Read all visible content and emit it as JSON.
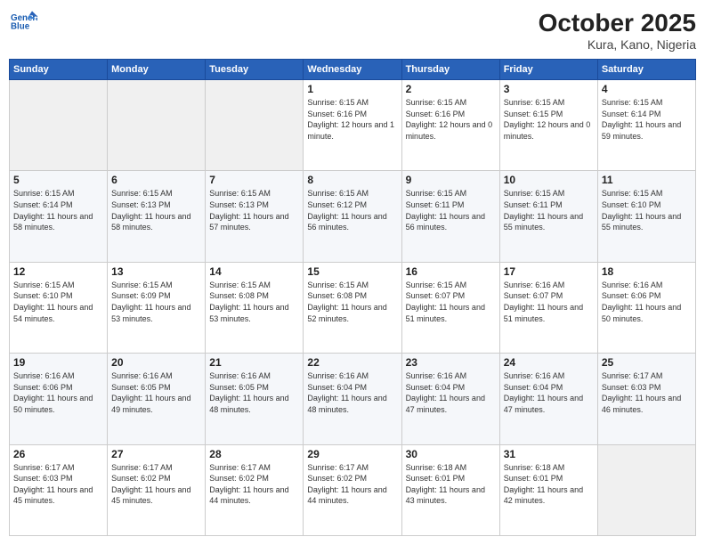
{
  "header": {
    "logo_line1": "General",
    "logo_line2": "Blue",
    "title": "October 2025",
    "subtitle": "Kura, Kano, Nigeria"
  },
  "weekdays": [
    "Sunday",
    "Monday",
    "Tuesday",
    "Wednesday",
    "Thursday",
    "Friday",
    "Saturday"
  ],
  "weeks": [
    [
      {
        "day": "",
        "sunrise": "",
        "sunset": "",
        "daylight": ""
      },
      {
        "day": "",
        "sunrise": "",
        "sunset": "",
        "daylight": ""
      },
      {
        "day": "",
        "sunrise": "",
        "sunset": "",
        "daylight": ""
      },
      {
        "day": "1",
        "sunrise": "Sunrise: 6:15 AM",
        "sunset": "Sunset: 6:16 PM",
        "daylight": "Daylight: 12 hours and 1 minute."
      },
      {
        "day": "2",
        "sunrise": "Sunrise: 6:15 AM",
        "sunset": "Sunset: 6:16 PM",
        "daylight": "Daylight: 12 hours and 0 minutes."
      },
      {
        "day": "3",
        "sunrise": "Sunrise: 6:15 AM",
        "sunset": "Sunset: 6:15 PM",
        "daylight": "Daylight: 12 hours and 0 minutes."
      },
      {
        "day": "4",
        "sunrise": "Sunrise: 6:15 AM",
        "sunset": "Sunset: 6:14 PM",
        "daylight": "Daylight: 11 hours and 59 minutes."
      }
    ],
    [
      {
        "day": "5",
        "sunrise": "Sunrise: 6:15 AM",
        "sunset": "Sunset: 6:14 PM",
        "daylight": "Daylight: 11 hours and 58 minutes."
      },
      {
        "day": "6",
        "sunrise": "Sunrise: 6:15 AM",
        "sunset": "Sunset: 6:13 PM",
        "daylight": "Daylight: 11 hours and 58 minutes."
      },
      {
        "day": "7",
        "sunrise": "Sunrise: 6:15 AM",
        "sunset": "Sunset: 6:13 PM",
        "daylight": "Daylight: 11 hours and 57 minutes."
      },
      {
        "day": "8",
        "sunrise": "Sunrise: 6:15 AM",
        "sunset": "Sunset: 6:12 PM",
        "daylight": "Daylight: 11 hours and 56 minutes."
      },
      {
        "day": "9",
        "sunrise": "Sunrise: 6:15 AM",
        "sunset": "Sunset: 6:11 PM",
        "daylight": "Daylight: 11 hours and 56 minutes."
      },
      {
        "day": "10",
        "sunrise": "Sunrise: 6:15 AM",
        "sunset": "Sunset: 6:11 PM",
        "daylight": "Daylight: 11 hours and 55 minutes."
      },
      {
        "day": "11",
        "sunrise": "Sunrise: 6:15 AM",
        "sunset": "Sunset: 6:10 PM",
        "daylight": "Daylight: 11 hours and 55 minutes."
      }
    ],
    [
      {
        "day": "12",
        "sunrise": "Sunrise: 6:15 AM",
        "sunset": "Sunset: 6:10 PM",
        "daylight": "Daylight: 11 hours and 54 minutes."
      },
      {
        "day": "13",
        "sunrise": "Sunrise: 6:15 AM",
        "sunset": "Sunset: 6:09 PM",
        "daylight": "Daylight: 11 hours and 53 minutes."
      },
      {
        "day": "14",
        "sunrise": "Sunrise: 6:15 AM",
        "sunset": "Sunset: 6:08 PM",
        "daylight": "Daylight: 11 hours and 53 minutes."
      },
      {
        "day": "15",
        "sunrise": "Sunrise: 6:15 AM",
        "sunset": "Sunset: 6:08 PM",
        "daylight": "Daylight: 11 hours and 52 minutes."
      },
      {
        "day": "16",
        "sunrise": "Sunrise: 6:15 AM",
        "sunset": "Sunset: 6:07 PM",
        "daylight": "Daylight: 11 hours and 51 minutes."
      },
      {
        "day": "17",
        "sunrise": "Sunrise: 6:16 AM",
        "sunset": "Sunset: 6:07 PM",
        "daylight": "Daylight: 11 hours and 51 minutes."
      },
      {
        "day": "18",
        "sunrise": "Sunrise: 6:16 AM",
        "sunset": "Sunset: 6:06 PM",
        "daylight": "Daylight: 11 hours and 50 minutes."
      }
    ],
    [
      {
        "day": "19",
        "sunrise": "Sunrise: 6:16 AM",
        "sunset": "Sunset: 6:06 PM",
        "daylight": "Daylight: 11 hours and 50 minutes."
      },
      {
        "day": "20",
        "sunrise": "Sunrise: 6:16 AM",
        "sunset": "Sunset: 6:05 PM",
        "daylight": "Daylight: 11 hours and 49 minutes."
      },
      {
        "day": "21",
        "sunrise": "Sunrise: 6:16 AM",
        "sunset": "Sunset: 6:05 PM",
        "daylight": "Daylight: 11 hours and 48 minutes."
      },
      {
        "day": "22",
        "sunrise": "Sunrise: 6:16 AM",
        "sunset": "Sunset: 6:04 PM",
        "daylight": "Daylight: 11 hours and 48 minutes."
      },
      {
        "day": "23",
        "sunrise": "Sunrise: 6:16 AM",
        "sunset": "Sunset: 6:04 PM",
        "daylight": "Daylight: 11 hours and 47 minutes."
      },
      {
        "day": "24",
        "sunrise": "Sunrise: 6:16 AM",
        "sunset": "Sunset: 6:04 PM",
        "daylight": "Daylight: 11 hours and 47 minutes."
      },
      {
        "day": "25",
        "sunrise": "Sunrise: 6:17 AM",
        "sunset": "Sunset: 6:03 PM",
        "daylight": "Daylight: 11 hours and 46 minutes."
      }
    ],
    [
      {
        "day": "26",
        "sunrise": "Sunrise: 6:17 AM",
        "sunset": "Sunset: 6:03 PM",
        "daylight": "Daylight: 11 hours and 45 minutes."
      },
      {
        "day": "27",
        "sunrise": "Sunrise: 6:17 AM",
        "sunset": "Sunset: 6:02 PM",
        "daylight": "Daylight: 11 hours and 45 minutes."
      },
      {
        "day": "28",
        "sunrise": "Sunrise: 6:17 AM",
        "sunset": "Sunset: 6:02 PM",
        "daylight": "Daylight: 11 hours and 44 minutes."
      },
      {
        "day": "29",
        "sunrise": "Sunrise: 6:17 AM",
        "sunset": "Sunset: 6:02 PM",
        "daylight": "Daylight: 11 hours and 44 minutes."
      },
      {
        "day": "30",
        "sunrise": "Sunrise: 6:18 AM",
        "sunset": "Sunset: 6:01 PM",
        "daylight": "Daylight: 11 hours and 43 minutes."
      },
      {
        "day": "31",
        "sunrise": "Sunrise: 6:18 AM",
        "sunset": "Sunset: 6:01 PM",
        "daylight": "Daylight: 11 hours and 42 minutes."
      },
      {
        "day": "",
        "sunrise": "",
        "sunset": "",
        "daylight": ""
      }
    ]
  ]
}
